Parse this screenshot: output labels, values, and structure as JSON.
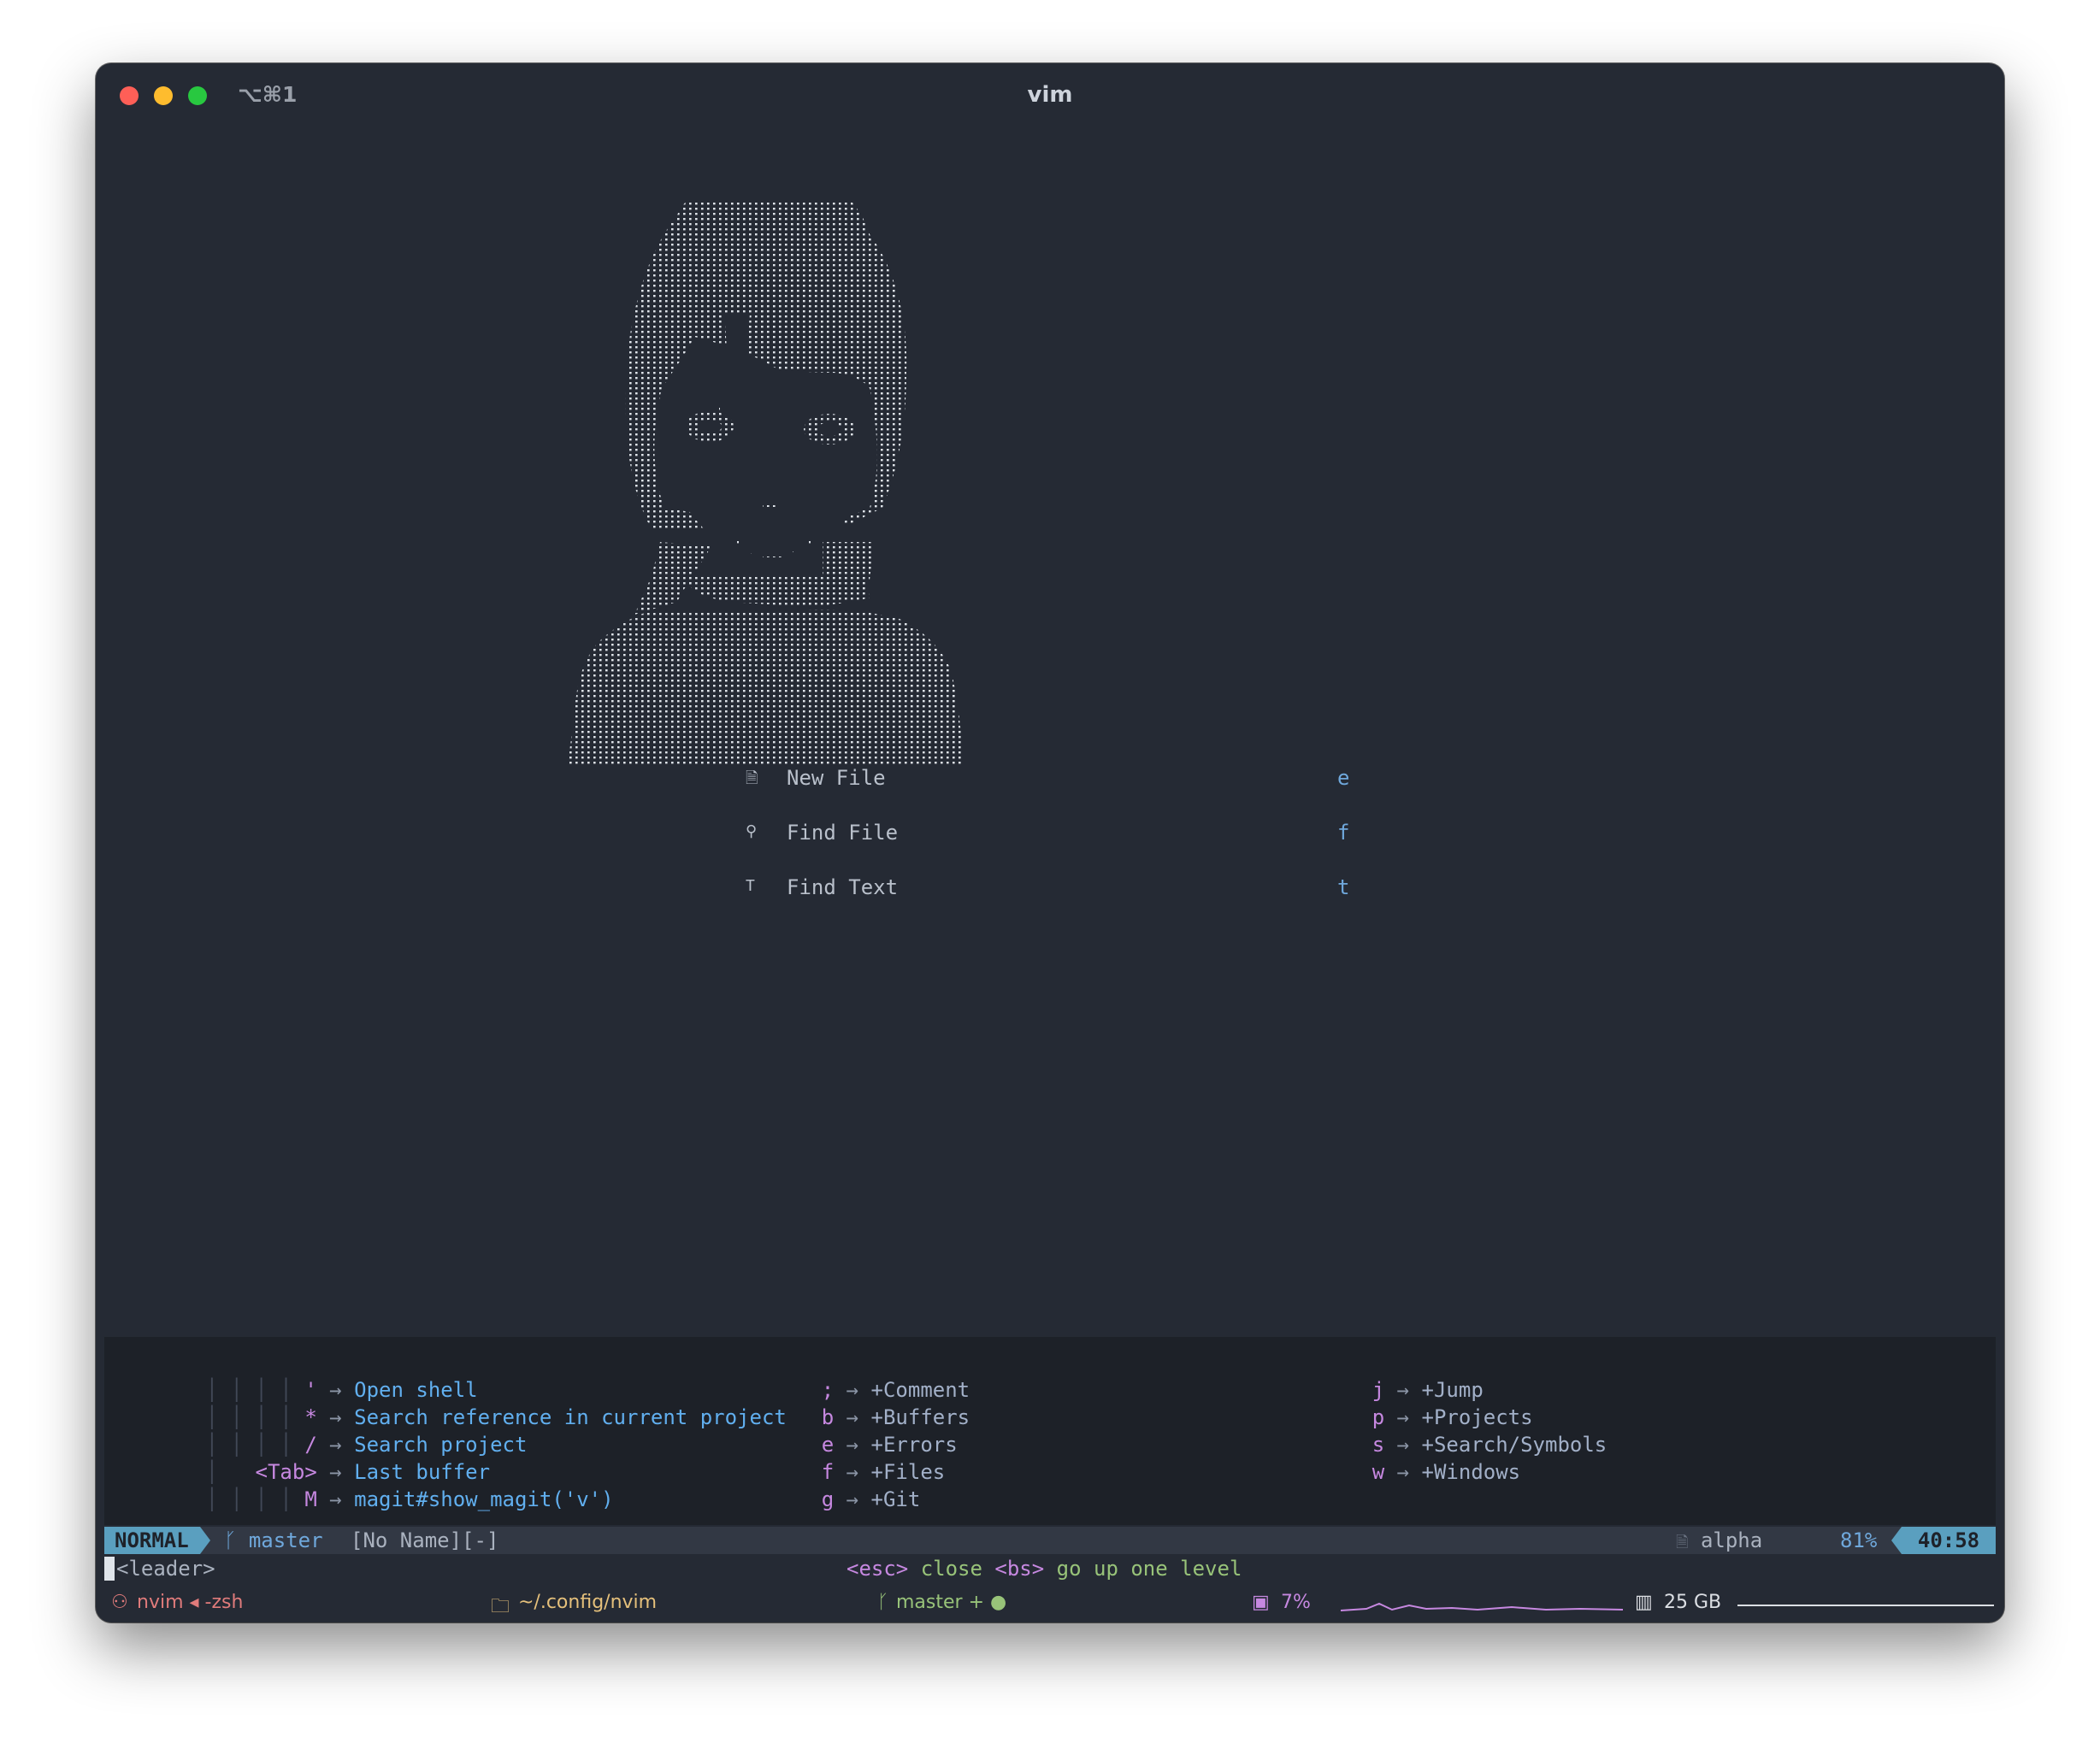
{
  "window": {
    "title": "vim",
    "shortcut": "⌥⌘1"
  },
  "dashboard": {
    "buttons": [
      {
        "icon": "🗎",
        "label": "New File",
        "key": "e"
      },
      {
        "icon": "⚲",
        "label": "Find File",
        "key": "f"
      },
      {
        "icon": "T",
        "label": "Find Text",
        "key": "t"
      }
    ]
  },
  "whichkey": {
    "left": [
      {
        "guides": "│ │ │ │",
        "key": "'",
        "desc": "Open shell"
      },
      {
        "guides": "│ │ │ │",
        "key": "*",
        "desc": "Search reference in current project"
      },
      {
        "guides": "│ │ │ │",
        "key": "/",
        "desc": "Search project"
      },
      {
        "guides": "│  ",
        "key": "<Tab>",
        "desc": "Last buffer"
      },
      {
        "guides": "│ │ │ │",
        "key": "M",
        "desc": "magit#show_magit('v')"
      }
    ],
    "middle": [
      {
        "key": ";",
        "desc": "+Comment"
      },
      {
        "key": "b",
        "desc": "+Buffers"
      },
      {
        "key": "e",
        "desc": "+Errors"
      },
      {
        "key": "f",
        "desc": "+Files"
      },
      {
        "key": "g",
        "desc": "+Git"
      }
    ],
    "right": [
      {
        "key": "j",
        "desc": "+Jump"
      },
      {
        "key": "p",
        "desc": "+Projects"
      },
      {
        "key": "s",
        "desc": "+Search/Symbols"
      },
      {
        "key": "w",
        "desc": "+Windows"
      }
    ],
    "arrow": "→"
  },
  "statusline": {
    "mode": "NORMAL",
    "branch_icon": "ᚴ",
    "branch": "master",
    "filename": "[No Name][-]",
    "filetype_icon": "🗎",
    "filetype": "alpha",
    "percent": "81%",
    "position": "40:58"
  },
  "cmdline": {
    "leader": "<leader>",
    "hint_esc_key": "<esc>",
    "hint_esc_text": "close",
    "hint_bs_key": "<bs>",
    "hint_bs_text": "go up one level"
  },
  "tmux": {
    "session_icon": "⚇",
    "session": "nvim ◂ -zsh",
    "dir_icon": "🗀",
    "dir": "~/.config/nvim",
    "git_icon": "ᚴ",
    "git": "master + ●",
    "cpu_icon": "▣",
    "cpu": "7%",
    "mem_icon": "▥",
    "mem": "25 GB"
  },
  "colors": {
    "background": "#252a34",
    "accent_blue": "#5a9fbf",
    "key_purple": "#c688e0",
    "hint_green": "#98c379",
    "ascii_art": "#dfe4ea"
  }
}
